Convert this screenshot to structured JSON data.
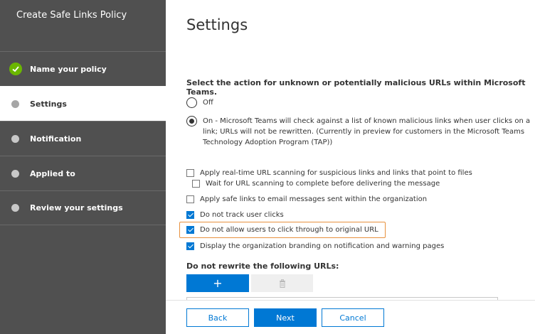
{
  "sidebar": {
    "title": "Create Safe Links Policy",
    "items": [
      {
        "label": "Name your policy",
        "state": "completed"
      },
      {
        "label": "Settings",
        "state": "active"
      },
      {
        "label": "Notification",
        "state": "pending"
      },
      {
        "label": "Applied to",
        "state": "pending"
      },
      {
        "label": "Review your settings",
        "state": "pending"
      }
    ]
  },
  "main": {
    "title": "Settings",
    "question": "Select the action for unknown or potentially malicious URLs within Microsoft Teams.",
    "radio_off": "Off",
    "radio_on_line1": "On - Microsoft Teams will check against a list of known malicious links when user clicks on a",
    "radio_on_line2": "link; URLs will not be rewritten. (Currently in preview for customers in the Microsoft Teams",
    "radio_on_line3": "Technology Adoption Program (TAP))",
    "checkboxes": [
      {
        "label": "Apply real-time URL scanning for suspicious links and links that point to files",
        "checked": false
      },
      {
        "label": "Wait for URL scanning to complete before delivering the message",
        "checked": false
      },
      {
        "label": "Apply safe links to email messages sent within the organization",
        "checked": false
      },
      {
        "label": "Do not track user clicks",
        "checked": true
      },
      {
        "label": "Do not allow users to click through to original URL",
        "checked": true
      },
      {
        "label": "Display the organization branding on notification and warning pages",
        "checked": true
      }
    ],
    "rewrite_title": "Do not rewrite the following URLs:",
    "add_symbol": "+"
  },
  "footer": {
    "back": "Back",
    "next": "Next",
    "cancel": "Cancel"
  },
  "colors": {
    "accent": "#0078d4",
    "sidebar_bg": "#505050",
    "check_green": "#6bb700",
    "highlight": "#e8913e"
  }
}
